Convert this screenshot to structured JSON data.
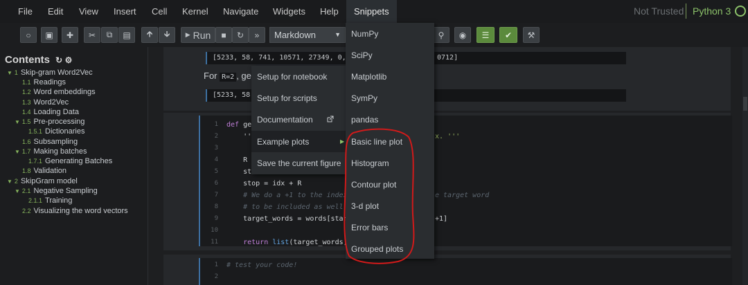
{
  "menubar": {
    "items": [
      "File",
      "Edit",
      "View",
      "Insert",
      "Cell",
      "Kernel",
      "Navigate",
      "Widgets",
      "Help",
      "Snippets"
    ],
    "trust": "Not Trusted",
    "kernel": "Python 3"
  },
  "toolbar": {
    "run_label": "Run",
    "cell_type": "Markdown"
  },
  "toc": {
    "title": "Contents",
    "items": [
      {
        "num": "1",
        "label": "Skip-gram Word2Vec"
      },
      {
        "num": "1.1",
        "label": "Readings"
      },
      {
        "num": "1.2",
        "label": "Word embeddings"
      },
      {
        "num": "1.3",
        "label": "Word2Vec"
      },
      {
        "num": "1.4",
        "label": "Loading Data"
      },
      {
        "num": "1.5",
        "label": "Pre-processing"
      },
      {
        "num": "1.5.1",
        "label": "Dictionaries"
      },
      {
        "num": "1.6",
        "label": "Subsampling"
      },
      {
        "num": "1.7",
        "label": "Making batches"
      },
      {
        "num": "1.7.1",
        "label": "Generating Batches"
      },
      {
        "num": "1.8",
        "label": "Validation"
      },
      {
        "num": "2",
        "label": "SkipGram model"
      },
      {
        "num": "2.1",
        "label": "Negative Sampling"
      },
      {
        "num": "2.1.1",
        "label": "Training"
      },
      {
        "num": "2.2",
        "label": "Visualizing the word vectors"
      }
    ]
  },
  "notebook": {
    "output1_left": "[5233, 58, 741, 10571, 27349, 0, 15",
    "output1_right": "0712]",
    "md_prefix": "For",
    "md_code": "R=2",
    "md_rest": ", get",
    "output2": "[5233, 58,",
    "code_lines": [
      {
        "n": "1",
        "t": "def get"
      },
      {
        "n": "2",
        "t": "    '''",
        "tail": "x. '''"
      },
      {
        "n": "3",
        "t": ""
      },
      {
        "n": "4",
        "t": "    R ="
      },
      {
        "n": "5",
        "t": "    sta"
      },
      {
        "n": "6",
        "t": "    stop = idx + R"
      },
      {
        "n": "7",
        "t": "    # We do a +1 to the index",
        "tail": "e target word"
      },
      {
        "n": "8",
        "t": "    # to be included as well"
      },
      {
        "n": "9",
        "t": "    target_words = words[start:",
        "tail": "+1]"
      },
      {
        "n": "10",
        "t": ""
      },
      {
        "n": "11",
        "t": "    return list(target_words)"
      }
    ],
    "code2_lines": [
      {
        "n": "1",
        "t": "# test your code!"
      },
      {
        "n": "2",
        "t": ""
      }
    ]
  },
  "snippets_menu": {
    "items": [
      "Setup for notebook",
      "Setup for scripts",
      "Documentation",
      "Example plots",
      "Save the current figure"
    ],
    "active_index": 3
  },
  "snippets_submenu": {
    "items": [
      "NumPy",
      "SciPy",
      "Matplotlib",
      "SymPy",
      "pandas",
      "Basic line plot",
      "Histogram",
      "Contour plot",
      "3-d plot",
      "Error bars",
      "Grouped plots"
    ]
  },
  "colors": {
    "accent_green": "#8cc26a",
    "annotation_red": "#d11a1a",
    "menu_bg": "#2a2d30"
  }
}
